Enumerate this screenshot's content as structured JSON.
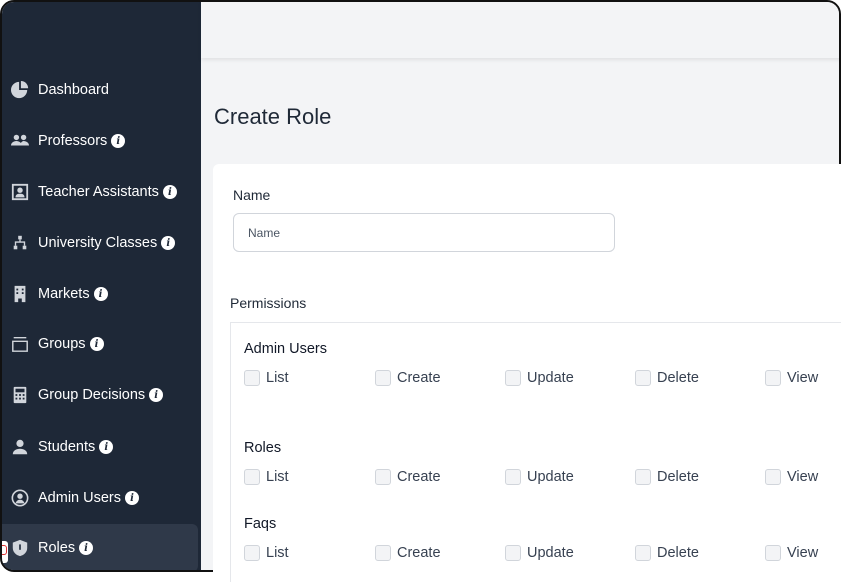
{
  "sidebar": {
    "items": [
      {
        "label": "Dashboard",
        "icon": "pie-chart-icon",
        "info": false
      },
      {
        "label": "Professors",
        "icon": "users-icon",
        "info": true
      },
      {
        "label": "Teacher Assistants",
        "icon": "portrait-icon",
        "info": true
      },
      {
        "label": "University Classes",
        "icon": "sitemap-icon",
        "info": true
      },
      {
        "label": "Markets",
        "icon": "building-icon",
        "info": true
      },
      {
        "label": "Groups",
        "icon": "tray-icon",
        "info": true
      },
      {
        "label": "Group Decisions",
        "icon": "calculator-icon",
        "info": true
      },
      {
        "label": "Students",
        "icon": "user-icon",
        "info": true
      },
      {
        "label": "Admin Users",
        "icon": "user-circle-icon",
        "info": true
      },
      {
        "label": "Roles",
        "icon": "shield-icon",
        "info": true,
        "active": true
      }
    ],
    "info_glyph": "i"
  },
  "main": {
    "title": "Create Role",
    "name_label": "Name",
    "name_placeholder": "Name",
    "permissions_label": "Permissions",
    "groups": [
      {
        "title": "Admin Users",
        "options": [
          "List",
          "Create",
          "Update",
          "Delete",
          "View"
        ]
      },
      {
        "title": "Roles",
        "options": [
          "List",
          "Create",
          "Update",
          "Delete",
          "View"
        ]
      },
      {
        "title": "Faqs",
        "options": [
          "List",
          "Create",
          "Update",
          "Delete",
          "View"
        ]
      }
    ]
  },
  "colors": {
    "sidebar_bg": "#1e2837",
    "active_item_bg": "#2f3949",
    "page_bg": "#f3f4f6"
  }
}
